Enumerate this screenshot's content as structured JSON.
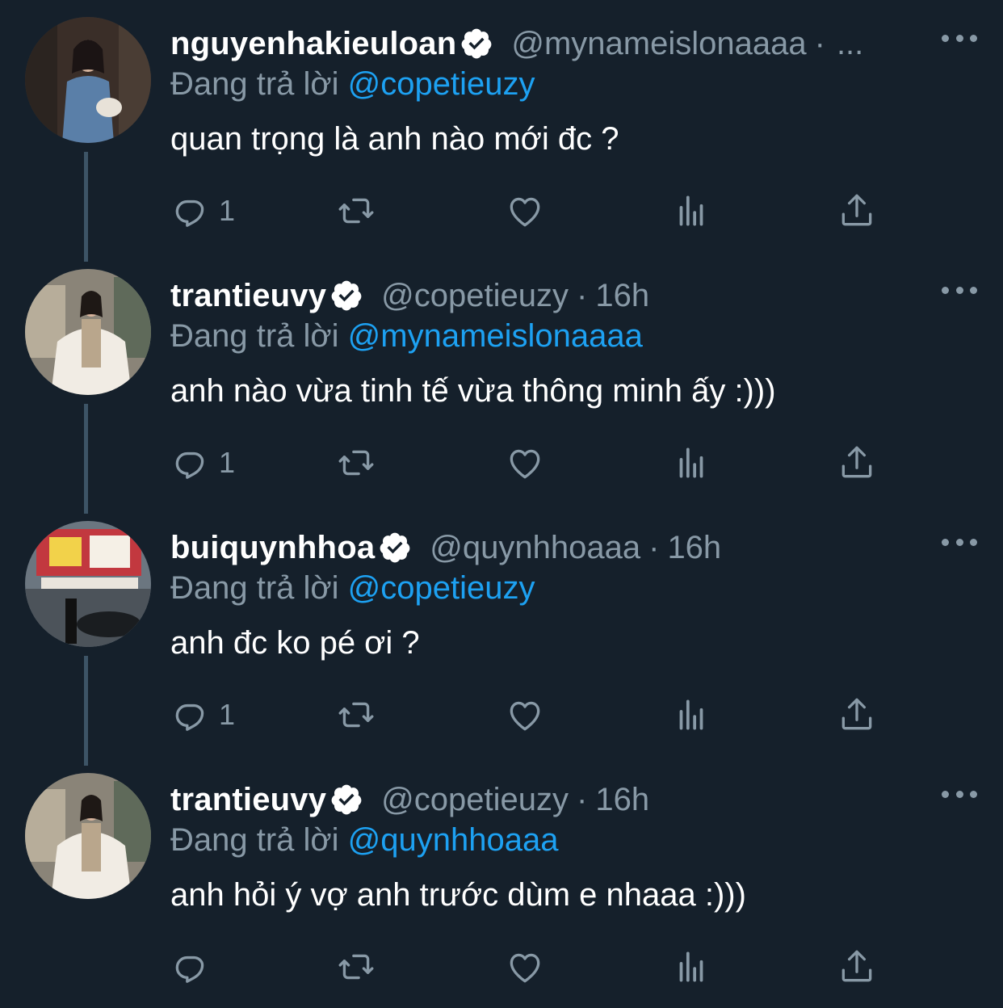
{
  "thread": [
    {
      "name": "nguyenhakieuloan",
      "handle": "@mynameislonaaaa",
      "separator": "·",
      "time": "",
      "ellipsis": "...",
      "reply_prefix": "Đang trả lời",
      "reply_to": "@copetieuzy",
      "text": "quan trọng là anh nào mới đc ?",
      "reply_count": "1",
      "avatar": "portrait-woman-denim-dress"
    },
    {
      "name": "trantieuvy",
      "handle": "@copetieuzy",
      "separator": "·",
      "time": "16h",
      "ellipsis": "",
      "reply_prefix": "Đang trả lời",
      "reply_to": "@mynameislonaaaa",
      "text": "anh nào vừa tinh tế vừa thông minh ấy :)))",
      "reply_count": "1",
      "avatar": "portrait-woman-white-fur"
    },
    {
      "name": "buiquynhhoa",
      "handle": "@quynhhoaaa",
      "separator": "·",
      "time": "16h",
      "ellipsis": "",
      "reply_prefix": "Đang trả lời",
      "reply_to": "@copetieuzy",
      "text": "anh đc ko pé ơi ?",
      "reply_count": "1",
      "avatar": "street-scene-ramen-shop"
    },
    {
      "name": "trantieuvy",
      "handle": "@copetieuzy",
      "separator": "·",
      "time": "16h",
      "ellipsis": "",
      "reply_prefix": "Đang trả lời",
      "reply_to": "@quynhhoaaa",
      "text": "anh hỏi ý vợ anh trước dùm e nhaaa :)))",
      "reply_count": "",
      "avatar": "portrait-woman-white-fur"
    }
  ],
  "icons": {
    "verified": "verified-badge-icon",
    "reply": "reply-icon",
    "retweet": "retweet-icon",
    "like": "like-icon",
    "analytics": "analytics-icon",
    "share": "share-icon",
    "more": "more-icon"
  },
  "colors": {
    "background": "#15202b",
    "secondary_text": "#8899a6",
    "link": "#1da1f2",
    "primary_text": "#ffffff",
    "thread_line": "#3d5466"
  }
}
